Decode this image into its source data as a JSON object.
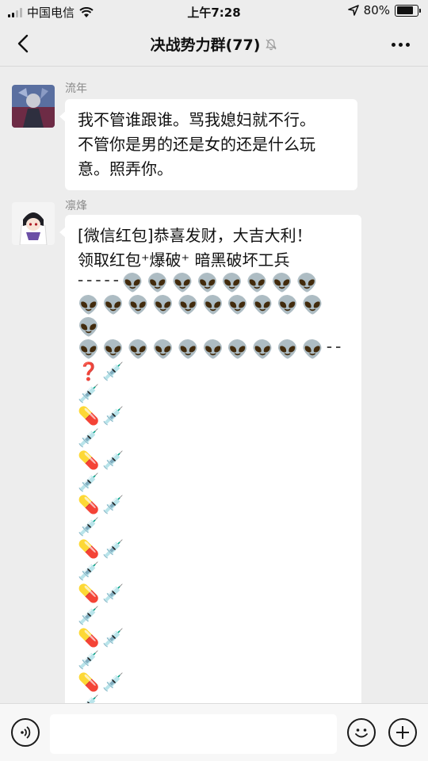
{
  "status_bar": {
    "carrier": "中国电信",
    "time": "上午7:28",
    "battery": "80%",
    "battery_level": 0.8,
    "signal_bars": 2
  },
  "header": {
    "title": "决战势力群(77)",
    "mute_icon": "bell-muted-icon",
    "back_icon": "chevron-left-icon",
    "more_icon": "more-dots-icon"
  },
  "messages": [
    {
      "sender": "流年",
      "lines": [
        "我不管谁跟谁。骂我媳妇就不行。",
        "不管你是男的还是女的还是什么玩",
        "意。照弄你。"
      ]
    },
    {
      "sender": "凛烽",
      "lines": [
        "[微信红包]恭喜发财，大吉大利！",
        "领取红包⁺爆破⁺ 暗黑破坏工兵"
      ],
      "emoji_lines": [
        "ᱼᱼᱼᱼᱼ👽👽👽👽👽👽👽👽",
        "👽👽👽👽👽👽👽👽👽👽👽",
        "👽👽👽👽👽👽👽👽👽👽ᱼᱼ",
        "❓💉",
        "💉",
        "💊💉",
        "💉",
        "💊💉",
        "💉",
        "💊💉",
        "💉",
        "💊💉",
        "💉",
        "💊💉",
        "💉",
        "💊💉",
        "💉",
        "💊💉",
        "💉",
        "💊💉"
      ]
    }
  ],
  "input_bar": {
    "voice_icon": "voice-icon",
    "emoji_icon": "emoji-face-icon",
    "plus_icon": "plus-icon"
  }
}
